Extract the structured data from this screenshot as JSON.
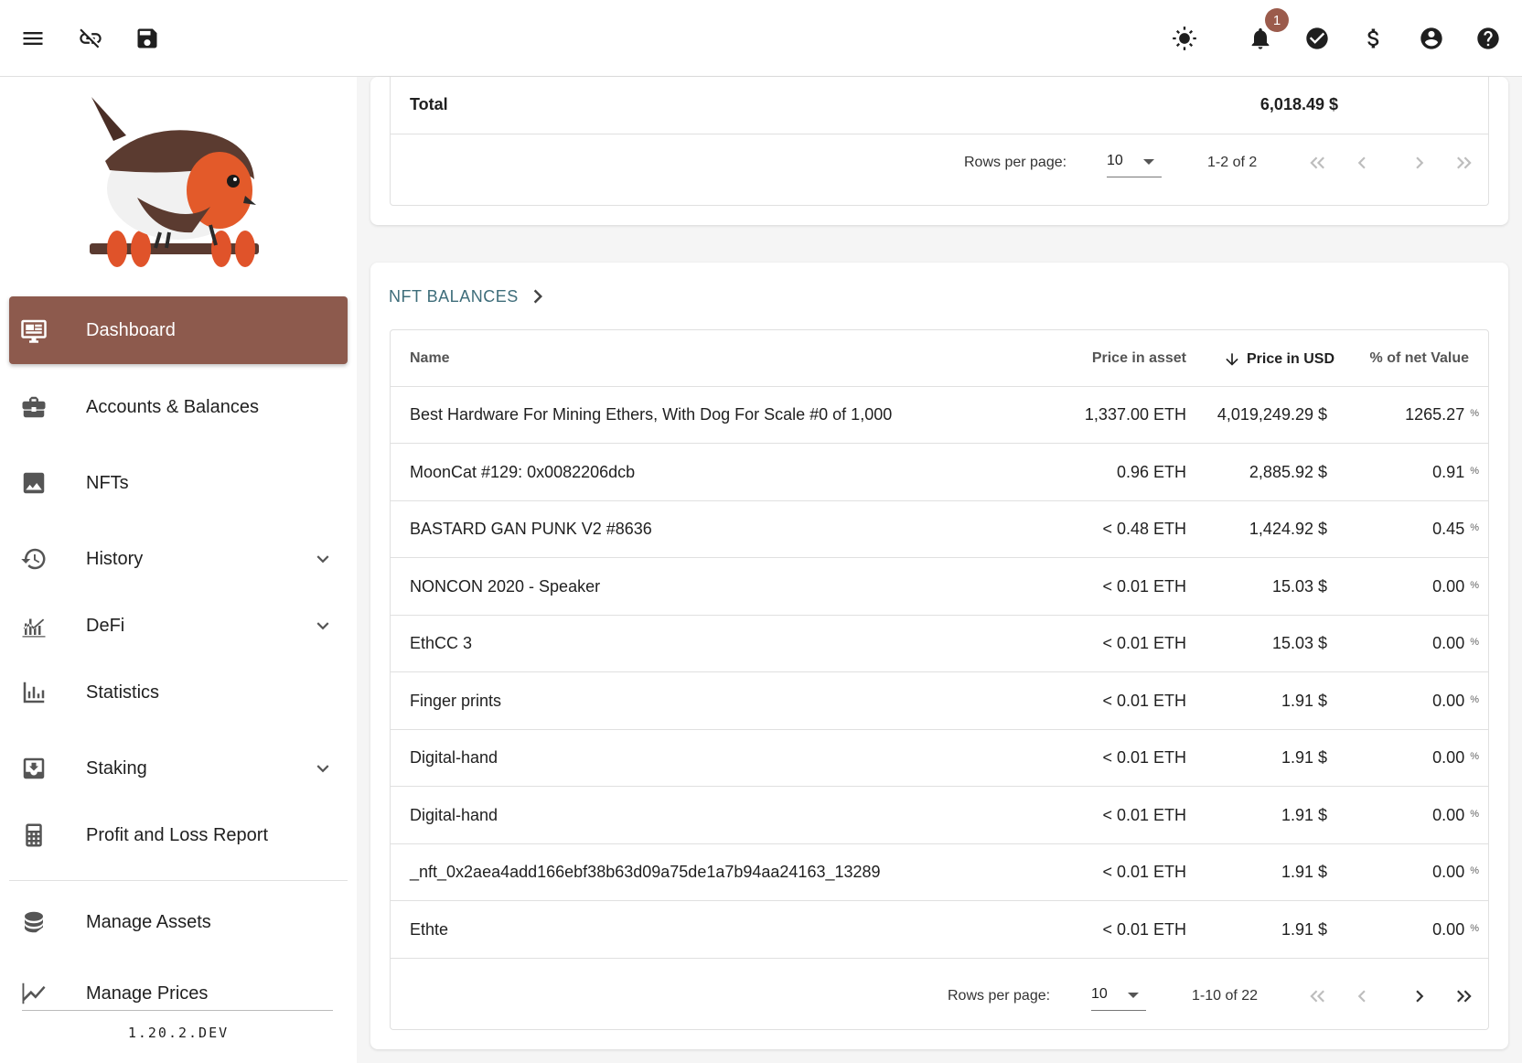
{
  "topbar": {
    "icons": [
      "menu-icon",
      "link-off-icon",
      "save-icon",
      "theme-icon",
      "bell-icon",
      "check-circle-icon",
      "dollar-icon",
      "account-icon",
      "help-icon"
    ],
    "notification_count": "1"
  },
  "sidebar": {
    "items": [
      {
        "label": "Dashboard",
        "icon": "monitor-dashboard-icon",
        "active": true
      },
      {
        "label": "Accounts & Balances",
        "icon": "briefcase-icon"
      },
      {
        "label": "NFTs",
        "icon": "image-icon"
      },
      {
        "label": "History",
        "icon": "history-icon",
        "expandable": true
      },
      {
        "label": "DeFi",
        "icon": "defi-chart-icon",
        "expandable": true
      },
      {
        "label": "Statistics",
        "icon": "bar-chart-icon"
      },
      {
        "label": "Staking",
        "icon": "staking-download-icon",
        "expandable": true
      },
      {
        "label": "Profit and Loss Report",
        "icon": "calculator-icon"
      },
      {
        "label": "Manage Assets",
        "icon": "database-icon"
      },
      {
        "label": "Manage Prices",
        "icon": "line-chart-icon"
      }
    ],
    "version": "1.20.2.DEV"
  },
  "top_card": {
    "total_label": "Total",
    "total_value": "6,018.49 $",
    "pager": {
      "rows_per_page_label": "Rows per page:",
      "rows_per_page": "10",
      "range": "1-2 of 2"
    }
  },
  "nft_card": {
    "title": "NFT BALANCES",
    "columns": {
      "name": "Name",
      "price_asset": "Price in asset",
      "price_usd": "Price in USD",
      "percent": "% of net Value"
    },
    "sort": {
      "column": "price_usd",
      "direction": "desc"
    },
    "rows": [
      {
        "name": "Best Hardware For Mining Ethers, With Dog For Scale #0 of 1,000",
        "price_asset": "1,337.00 ETH",
        "price_usd": "4,019,249.29 $",
        "percent": "1265.27"
      },
      {
        "name": "MoonCat #129: 0x0082206dcb",
        "price_asset": "0.96 ETH",
        "price_usd": "2,885.92 $",
        "percent": "0.91"
      },
      {
        "name": "BASTARD GAN PUNK V2 #8636",
        "price_asset": "< 0.48 ETH",
        "price_usd": "1,424.92 $",
        "percent": "0.45"
      },
      {
        "name": "NONCON 2020 - Speaker",
        "price_asset": "< 0.01 ETH",
        "price_usd": "15.03 $",
        "percent": "0.00"
      },
      {
        "name": "EthCC 3",
        "price_asset": "< 0.01 ETH",
        "price_usd": "15.03 $",
        "percent": "0.00"
      },
      {
        "name": "Finger prints",
        "price_asset": "< 0.01 ETH",
        "price_usd": "1.91 $",
        "percent": "0.00"
      },
      {
        "name": "Digital-hand",
        "price_asset": "< 0.01 ETH",
        "price_usd": "1.91 $",
        "percent": "0.00"
      },
      {
        "name": "Digital-hand",
        "price_asset": "< 0.01 ETH",
        "price_usd": "1.91 $",
        "percent": "0.00"
      },
      {
        "name": "_nft_0x2aea4add166ebf38b63d09a75de1a7b94aa24163_13289",
        "price_asset": "< 0.01 ETH",
        "price_usd": "1.91 $",
        "percent": "0.00"
      },
      {
        "name": "Ethte",
        "price_asset": "< 0.01 ETH",
        "price_usd": "1.91 $",
        "percent": "0.00"
      }
    ],
    "percent_sign": "%",
    "pager": {
      "rows_per_page_label": "Rows per page:",
      "rows_per_page": "10",
      "range": "1-10 of 22"
    }
  },
  "colors": {
    "accent": "#8d5a4d",
    "title": "#3e6d7a",
    "badge": "#9b5b4c"
  }
}
